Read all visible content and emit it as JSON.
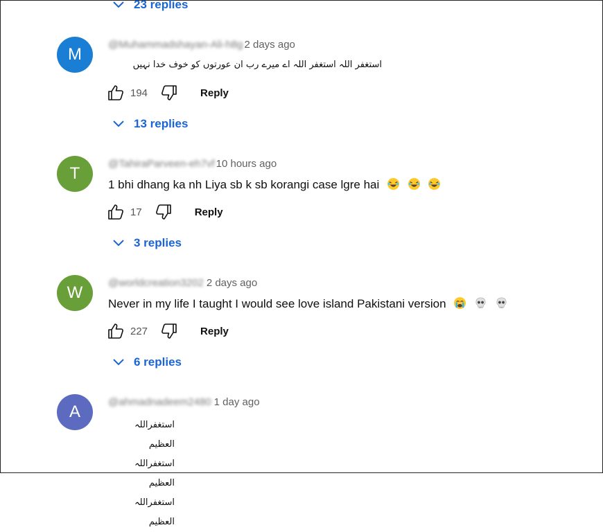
{
  "top_replies": {
    "label": "23 replies"
  },
  "comments": [
    {
      "avatar_letter": "M",
      "avatar_color": "#1a7fd4",
      "handle": "@Muhammadshayan-Ali-h8g",
      "time": "2 days ago",
      "text": "استغفر اللہ استغفر اللہ اے میرے رب ان عورتوں کو خوف خدا نہیں",
      "likes": "194",
      "reply_label": "Reply",
      "replies_label": "13 replies"
    },
    {
      "avatar_letter": "T",
      "avatar_color": "#689f38",
      "handle": "@TahiraParveen-eh7vf",
      "time": "10 hours ago",
      "text": "1 bhi dhang ka nh Liya sb k sb korangi case lgre hai",
      "emojis": [
        "laughing-emoji",
        "laughing-emoji",
        "laughing-emoji"
      ],
      "likes": "17",
      "reply_label": "Reply",
      "replies_label": "3 replies"
    },
    {
      "avatar_letter": "W",
      "avatar_color": "#689f38",
      "handle": "@worldcreation3202",
      "time": "2 days ago",
      "text": "Never in my life I taught I would see love island Pakistani version",
      "emojis": [
        "crying-emoji",
        "skull-emoji",
        "skull-emoji"
      ],
      "likes": "227",
      "reply_label": "Reply",
      "replies_label": "6 replies"
    },
    {
      "avatar_letter": "A",
      "avatar_color": "#5c6bc0",
      "handle": "@ahmadnadeem2480",
      "time": "1 day ago",
      "lines": [
        "استغفراللہ العظیم",
        "استغفراللہ العظیم",
        "استغفراللہ العظیم"
      ]
    }
  ]
}
